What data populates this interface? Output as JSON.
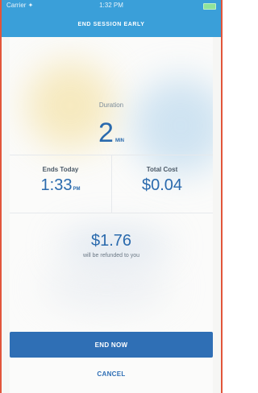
{
  "status_bar": {
    "carrier": "Carrier ✦",
    "time": "1:32 PM"
  },
  "header": {
    "title": "END SESSION EARLY"
  },
  "duration": {
    "label": "Duration",
    "value": "2",
    "unit": "MIN"
  },
  "ends": {
    "label": "Ends Today",
    "value": "1:33",
    "suffix": "PM"
  },
  "cost": {
    "label": "Total Cost",
    "value": "$0.04"
  },
  "refund": {
    "amount": "$1.76",
    "caption": "will be refunded to you"
  },
  "actions": {
    "end_now": "END NOW",
    "cancel": "CANCEL"
  },
  "colors": {
    "header": "#3a9fd9",
    "accent": "#2a6aad",
    "button": "#2f6fb5",
    "frame_border": "#e2553a"
  }
}
